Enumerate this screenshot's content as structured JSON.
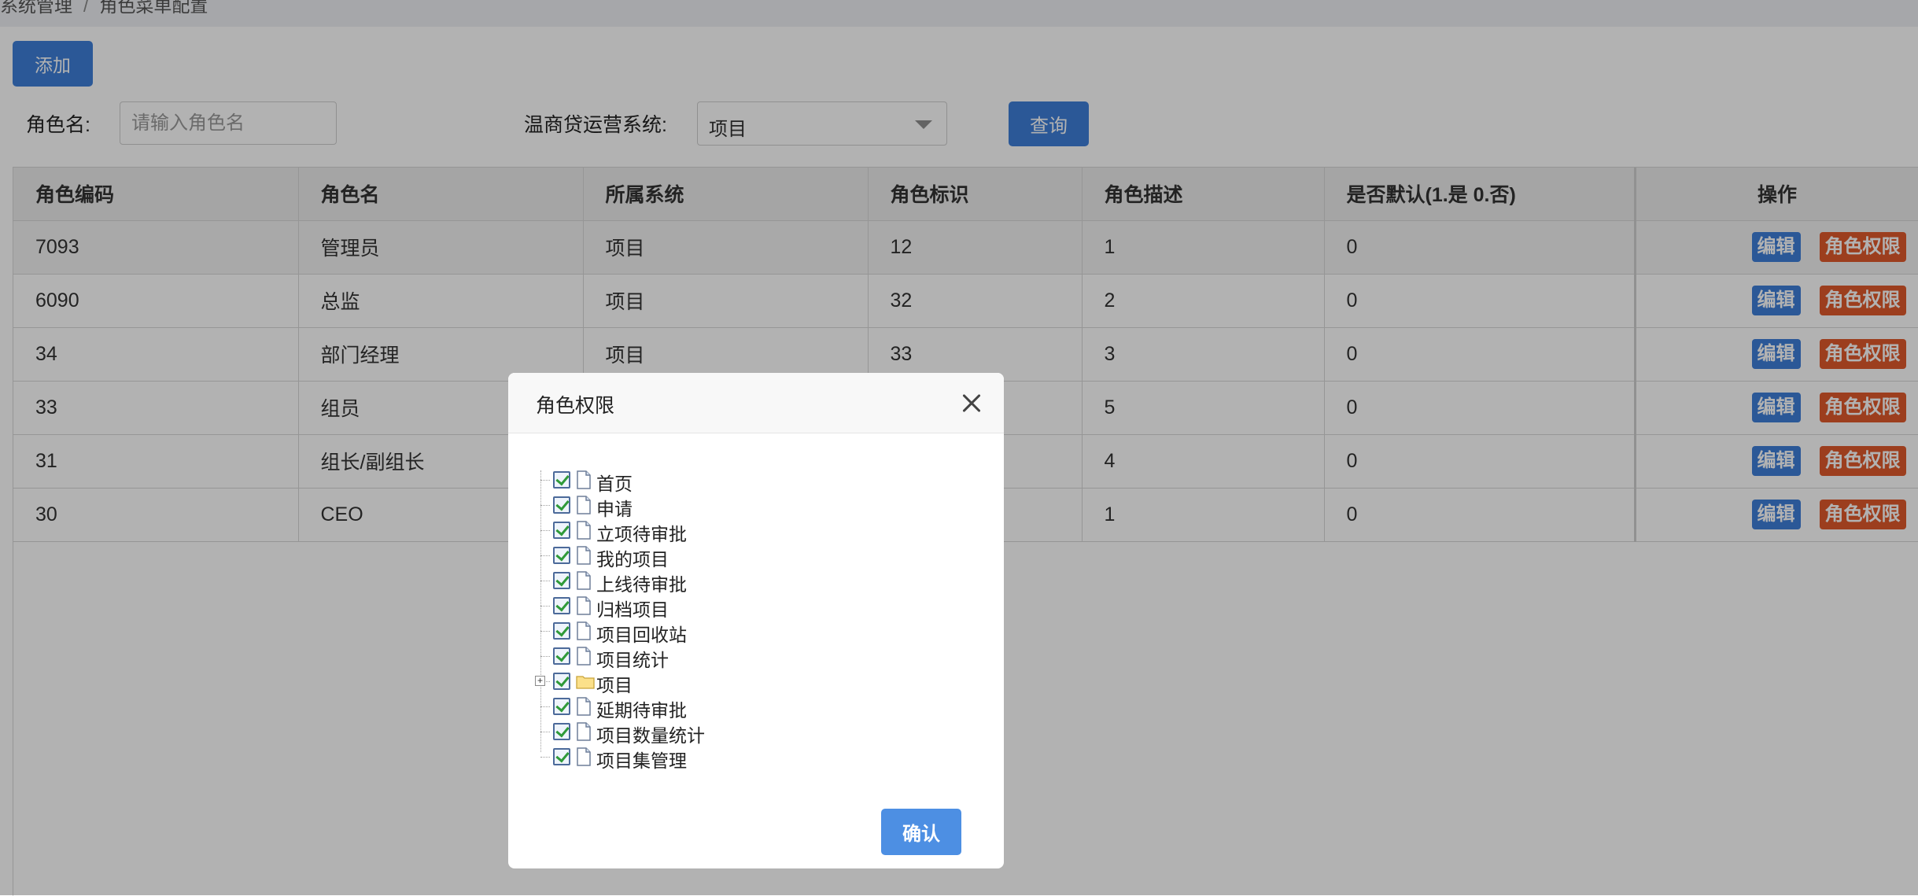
{
  "breadcrumb": {
    "parent": "系统管理",
    "separator": "/",
    "current": "角色菜单配置"
  },
  "toolbar": {
    "add_label": "添加"
  },
  "filters": {
    "role_name_label": "角色名:",
    "role_name_placeholder": "请输入角色名",
    "role_name_value": "",
    "system_label": "温商贷运营系统:",
    "system_value": "项目",
    "query_label": "查询"
  },
  "table": {
    "columns": [
      "角色编码",
      "角色名",
      "所属系统",
      "角色标识",
      "角色描述",
      "是否默认(1.是 0.否)",
      "操作"
    ],
    "rows": [
      [
        "7093",
        "管理员",
        "项目",
        "12",
        "1",
        "0"
      ],
      [
        "6090",
        "总监",
        "项目",
        "32",
        "2",
        "0"
      ],
      [
        "34",
        "部门经理",
        "项目",
        "33",
        "3",
        "0"
      ],
      [
        "33",
        "组员",
        "项目",
        "",
        "5",
        "0"
      ],
      [
        "31",
        "组长/副组长",
        "",
        "",
        "4",
        "0"
      ],
      [
        "30",
        "CEO",
        "",
        "",
        "1",
        "0"
      ]
    ],
    "row_actions": {
      "edit": "编辑",
      "permission": "角色权限"
    }
  },
  "modal": {
    "title": "角色权限",
    "confirm_label": "确认",
    "tree": [
      {
        "label": "首页",
        "checked": true,
        "type": "file"
      },
      {
        "label": "申请",
        "checked": true,
        "type": "file"
      },
      {
        "label": "立项待审批",
        "checked": true,
        "type": "file"
      },
      {
        "label": "我的项目",
        "checked": true,
        "type": "file"
      },
      {
        "label": "上线待审批",
        "checked": true,
        "type": "file"
      },
      {
        "label": "归档项目",
        "checked": true,
        "type": "file"
      },
      {
        "label": "项目回收站",
        "checked": true,
        "type": "file"
      },
      {
        "label": "项目统计",
        "checked": true,
        "type": "file"
      },
      {
        "label": "项目",
        "checked": true,
        "type": "folder",
        "collapsed": true
      },
      {
        "label": "延期待审批",
        "checked": true,
        "type": "file"
      },
      {
        "label": "项目数量统计",
        "checked": true,
        "type": "file"
      },
      {
        "label": "项目集管理",
        "checked": true,
        "type": "file"
      }
    ]
  },
  "colors": {
    "primary": "#3e7fd8",
    "danger": "#e05a2b",
    "checkmark": "#2f9a39"
  }
}
